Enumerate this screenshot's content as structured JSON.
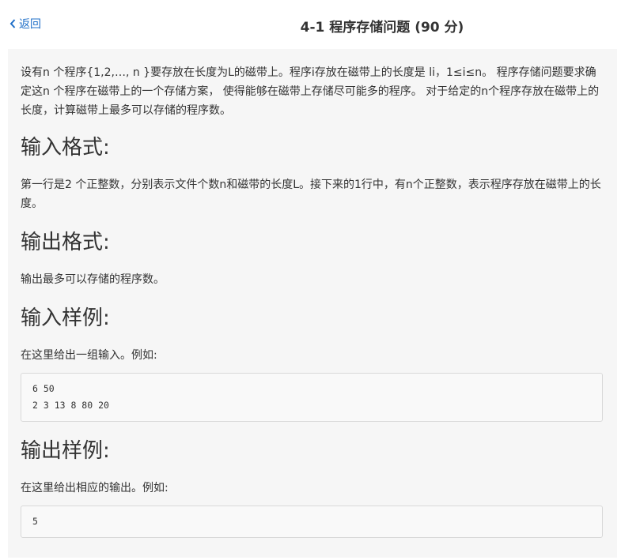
{
  "header": {
    "back_label": "返回",
    "title": "4-1 程序存储问题 (90 分)"
  },
  "problem": {
    "description": "设有n 个程序{1,2,…, n }要存放在长度为L的磁带上。程序i存放在磁带上的长度是 li，1≤i≤n。 程序存储问题要求确定这n 个程序在磁带上的一个存储方案， 使得能够在磁带上存储尽可能多的程序。 对于给定的n个程序存放在磁带上的长度，计算磁带上最多可以存储的程序数。",
    "input_heading": "输入格式:",
    "input_text": "第一行是2 个正整数，分别表示文件个数n和磁带的长度L。接下来的1行中，有n个正整数，表示程序存放在磁带上的长度。",
    "output_heading": "输出格式:",
    "output_text": "输出最多可以存储的程序数。",
    "sample_input_heading": "输入样例:",
    "sample_input_intro": "在这里给出一组输入。例如:",
    "sample_input_lines": [
      "6 50",
      "2 3 13 8 80 20"
    ],
    "sample_output_heading": "输出样例:",
    "sample_output_intro": "在这里给出相应的输出。例如:",
    "sample_output_lines": [
      "5"
    ]
  }
}
